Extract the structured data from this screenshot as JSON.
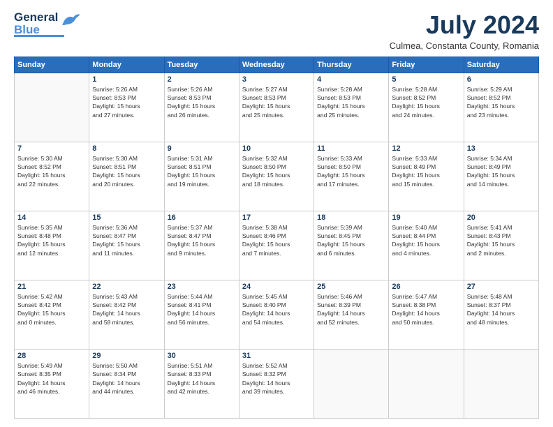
{
  "header": {
    "logo_line1": "General",
    "logo_line2": "Blue",
    "month_title": "July 2024",
    "location": "Culmea, Constanta County, Romania"
  },
  "weekdays": [
    "Sunday",
    "Monday",
    "Tuesday",
    "Wednesday",
    "Thursday",
    "Friday",
    "Saturday"
  ],
  "weeks": [
    [
      {
        "day": "",
        "info": ""
      },
      {
        "day": "1",
        "info": "Sunrise: 5:26 AM\nSunset: 8:53 PM\nDaylight: 15 hours\nand 27 minutes."
      },
      {
        "day": "2",
        "info": "Sunrise: 5:26 AM\nSunset: 8:53 PM\nDaylight: 15 hours\nand 26 minutes."
      },
      {
        "day": "3",
        "info": "Sunrise: 5:27 AM\nSunset: 8:53 PM\nDaylight: 15 hours\nand 25 minutes."
      },
      {
        "day": "4",
        "info": "Sunrise: 5:28 AM\nSunset: 8:53 PM\nDaylight: 15 hours\nand 25 minutes."
      },
      {
        "day": "5",
        "info": "Sunrise: 5:28 AM\nSunset: 8:52 PM\nDaylight: 15 hours\nand 24 minutes."
      },
      {
        "day": "6",
        "info": "Sunrise: 5:29 AM\nSunset: 8:52 PM\nDaylight: 15 hours\nand 23 minutes."
      }
    ],
    [
      {
        "day": "7",
        "info": "Sunrise: 5:30 AM\nSunset: 8:52 PM\nDaylight: 15 hours\nand 22 minutes."
      },
      {
        "day": "8",
        "info": "Sunrise: 5:30 AM\nSunset: 8:51 PM\nDaylight: 15 hours\nand 20 minutes."
      },
      {
        "day": "9",
        "info": "Sunrise: 5:31 AM\nSunset: 8:51 PM\nDaylight: 15 hours\nand 19 minutes."
      },
      {
        "day": "10",
        "info": "Sunrise: 5:32 AM\nSunset: 8:50 PM\nDaylight: 15 hours\nand 18 minutes."
      },
      {
        "day": "11",
        "info": "Sunrise: 5:33 AM\nSunset: 8:50 PM\nDaylight: 15 hours\nand 17 minutes."
      },
      {
        "day": "12",
        "info": "Sunrise: 5:33 AM\nSunset: 8:49 PM\nDaylight: 15 hours\nand 15 minutes."
      },
      {
        "day": "13",
        "info": "Sunrise: 5:34 AM\nSunset: 8:49 PM\nDaylight: 15 hours\nand 14 minutes."
      }
    ],
    [
      {
        "day": "14",
        "info": "Sunrise: 5:35 AM\nSunset: 8:48 PM\nDaylight: 15 hours\nand 12 minutes."
      },
      {
        "day": "15",
        "info": "Sunrise: 5:36 AM\nSunset: 8:47 PM\nDaylight: 15 hours\nand 11 minutes."
      },
      {
        "day": "16",
        "info": "Sunrise: 5:37 AM\nSunset: 8:47 PM\nDaylight: 15 hours\nand 9 minutes."
      },
      {
        "day": "17",
        "info": "Sunrise: 5:38 AM\nSunset: 8:46 PM\nDaylight: 15 hours\nand 7 minutes."
      },
      {
        "day": "18",
        "info": "Sunrise: 5:39 AM\nSunset: 8:45 PM\nDaylight: 15 hours\nand 6 minutes."
      },
      {
        "day": "19",
        "info": "Sunrise: 5:40 AM\nSunset: 8:44 PM\nDaylight: 15 hours\nand 4 minutes."
      },
      {
        "day": "20",
        "info": "Sunrise: 5:41 AM\nSunset: 8:43 PM\nDaylight: 15 hours\nand 2 minutes."
      }
    ],
    [
      {
        "day": "21",
        "info": "Sunrise: 5:42 AM\nSunset: 8:42 PM\nDaylight: 15 hours\nand 0 minutes."
      },
      {
        "day": "22",
        "info": "Sunrise: 5:43 AM\nSunset: 8:42 PM\nDaylight: 14 hours\nand 58 minutes."
      },
      {
        "day": "23",
        "info": "Sunrise: 5:44 AM\nSunset: 8:41 PM\nDaylight: 14 hours\nand 56 minutes."
      },
      {
        "day": "24",
        "info": "Sunrise: 5:45 AM\nSunset: 8:40 PM\nDaylight: 14 hours\nand 54 minutes."
      },
      {
        "day": "25",
        "info": "Sunrise: 5:46 AM\nSunset: 8:39 PM\nDaylight: 14 hours\nand 52 minutes."
      },
      {
        "day": "26",
        "info": "Sunrise: 5:47 AM\nSunset: 8:38 PM\nDaylight: 14 hours\nand 50 minutes."
      },
      {
        "day": "27",
        "info": "Sunrise: 5:48 AM\nSunset: 8:37 PM\nDaylight: 14 hours\nand 48 minutes."
      }
    ],
    [
      {
        "day": "28",
        "info": "Sunrise: 5:49 AM\nSunset: 8:35 PM\nDaylight: 14 hours\nand 46 minutes."
      },
      {
        "day": "29",
        "info": "Sunrise: 5:50 AM\nSunset: 8:34 PM\nDaylight: 14 hours\nand 44 minutes."
      },
      {
        "day": "30",
        "info": "Sunrise: 5:51 AM\nSunset: 8:33 PM\nDaylight: 14 hours\nand 42 minutes."
      },
      {
        "day": "31",
        "info": "Sunrise: 5:52 AM\nSunset: 8:32 PM\nDaylight: 14 hours\nand 39 minutes."
      },
      {
        "day": "",
        "info": ""
      },
      {
        "day": "",
        "info": ""
      },
      {
        "day": "",
        "info": ""
      }
    ]
  ]
}
